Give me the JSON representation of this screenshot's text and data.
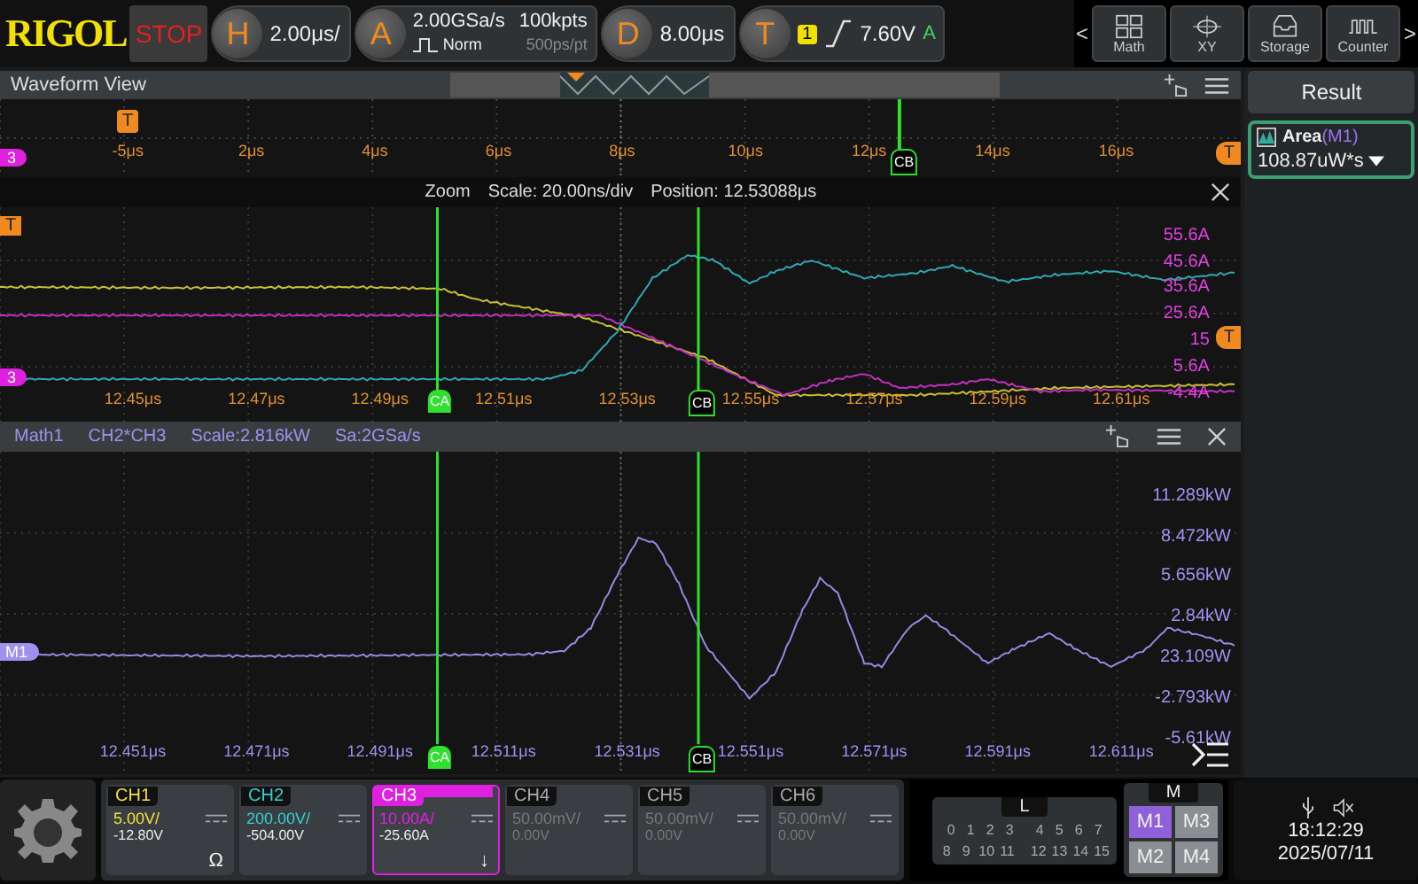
{
  "top_bar": {
    "logo": "RIGOL",
    "run_state": "STOP",
    "horizontal": {
      "badge": "H",
      "value": "2.00μs/"
    },
    "acquire": {
      "badge": "A",
      "sample_rate": "2.00GSa/s",
      "mode": "Norm",
      "memory": "100kpts",
      "resolution": "500ps/pt"
    },
    "delay": {
      "badge": "D",
      "value": "8.00μs"
    },
    "trigger": {
      "badge": "T",
      "source": "1",
      "level": "7.60V",
      "status": "A"
    },
    "prev": "<",
    "next": ">",
    "apps": [
      {
        "label": "Math"
      },
      {
        "label": "XY"
      },
      {
        "label": "Storage"
      },
      {
        "label": "Counter"
      }
    ]
  },
  "waveform_view": {
    "title": "Waveform View",
    "overview": {
      "x_labels": [
        "-5μs",
        "2μs",
        "4μs",
        "6μs",
        "8μs",
        "10μs",
        "12μs",
        "14μs",
        "16μs"
      ],
      "channel_marker": "3",
      "trigger_marker": "T",
      "trigger_level_marker": "T",
      "cursor": "CB"
    },
    "zoom": {
      "label": "Zoom",
      "scale": "Scale: 20.00ns/div",
      "position": "Position: 12.53088μs",
      "y_labels": [
        "55.6A",
        "45.6A",
        "35.6A",
        "25.6A",
        "15",
        "5.6A",
        "-4.4A"
      ],
      "x_labels": [
        "12.45μs",
        "12.47μs",
        "12.49μs",
        "12.51μs",
        "12.53μs",
        "12.55μs",
        "12.57μs",
        "12.59μs",
        "12.61μs"
      ],
      "cursors": [
        "CA",
        "CB"
      ],
      "channel_marker": "3",
      "trigger_marker": "T",
      "trigger_level_marker": "T"
    }
  },
  "math_view": {
    "title": "Math1",
    "source": "CH2*CH3",
    "scale": "Scale:2.816kW",
    "sample_rate": "Sa:2GSa/s",
    "y_labels": [
      "11.289kW",
      "8.472kW",
      "5.656kW",
      "2.84kW",
      "23.109W",
      "-2.793kW",
      "-5.61kW"
    ],
    "x_labels": [
      "12.451μs",
      "12.471μs",
      "12.491μs",
      "12.511μs",
      "12.531μs",
      "12.551μs",
      "12.571μs",
      "12.591μs",
      "12.611μs"
    ],
    "cursors": [
      "CA",
      "CB"
    ],
    "marker": "M1"
  },
  "result_panel": {
    "title": "Result",
    "item": {
      "name": "Area",
      "source": "(M1)",
      "value": "108.87uW*s"
    }
  },
  "channels": [
    {
      "label": "CH1",
      "scale": "5.00V/",
      "offset": "-12.80V",
      "symbol": "Ω",
      "color": "#f2e23a",
      "on": true,
      "selected": false
    },
    {
      "label": "CH2",
      "scale": "200.00V/",
      "offset": "-504.00V",
      "color": "#35d0d0",
      "on": true,
      "selected": false
    },
    {
      "label": "CH3",
      "scale": "10.00A/",
      "offset": "-25.60A",
      "symbol": "↓",
      "color": "#e020e0",
      "on": true,
      "selected": true
    },
    {
      "label": "CH4",
      "scale": "50.00mV/",
      "offset": "0.00V",
      "on": false,
      "selected": false
    },
    {
      "label": "CH5",
      "scale": "50.00mV/",
      "offset": "0.00V",
      "on": false,
      "selected": false
    },
    {
      "label": "CH6",
      "scale": "50.00mV/",
      "offset": "0.00V",
      "on": false,
      "selected": false
    }
  ],
  "logic": {
    "title": "L",
    "rows": [
      [
        "0",
        "1",
        "2",
        "3",
        "4",
        "5",
        "6",
        "7"
      ],
      [
        "8",
        "9",
        "10",
        "11",
        "12",
        "13",
        "14",
        "15"
      ]
    ]
  },
  "math_buttons": {
    "title": "M",
    "items": [
      {
        "label": "M1",
        "on": true
      },
      {
        "label": "M3",
        "on": false
      },
      {
        "label": "M2",
        "on": false
      },
      {
        "label": "M4",
        "on": false
      }
    ]
  },
  "status": {
    "time": "18:12:29",
    "date": "2025/07/11"
  }
}
